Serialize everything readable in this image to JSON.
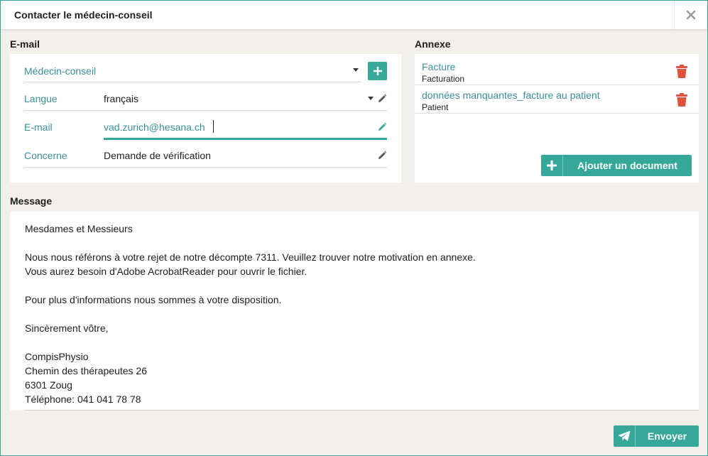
{
  "window": {
    "title": "Contacter le médecin-conseil"
  },
  "email": {
    "section_label": "E-mail",
    "recipient_placeholder": "Médecin-conseil",
    "language_label": "Langue",
    "language_value": "français",
    "email_label": "E-mail",
    "email_value": "vad.zurich@hesana.ch",
    "subject_label": "Concerne",
    "subject_value": "Demande de vérification"
  },
  "annex": {
    "section_label": "Annexe",
    "items": [
      {
        "name": "Facture",
        "category": "Facturation"
      },
      {
        "name": "données manquantes_facture au patient",
        "category": "Patient"
      }
    ],
    "add_document_label": "Ajouter un document"
  },
  "message": {
    "section_label": "Message",
    "lines": [
      "Mesdames et Messieurs",
      "",
      "Nous nous référons à votre rejet de notre décompte 7311. Veuillez trouver notre motivation en annexe.",
      "Vous aurez besoin d'Adobe AcrobatReader pour ouvrir le fichier.",
      "",
      "Pour plus d'informations nous sommes à votre disposition.",
      "",
      "Sincèrement vôtre,",
      "",
      "CompisPhysio",
      "Chemin des thérapeutes 26",
      "6301 Zoug",
      "Téléphone: 041 041 78 78"
    ]
  },
  "footer": {
    "send_label": "Envoyer"
  },
  "colors": {
    "accent": "#35a89a",
    "label_teal": "#3a8f9a",
    "delete_red": "#e0533f",
    "background": "#f3efeb"
  },
  "icons": [
    "close-icon",
    "chevron-down-icon",
    "pencil-icon",
    "plus-icon",
    "trash-icon",
    "paper-plane-icon"
  ]
}
